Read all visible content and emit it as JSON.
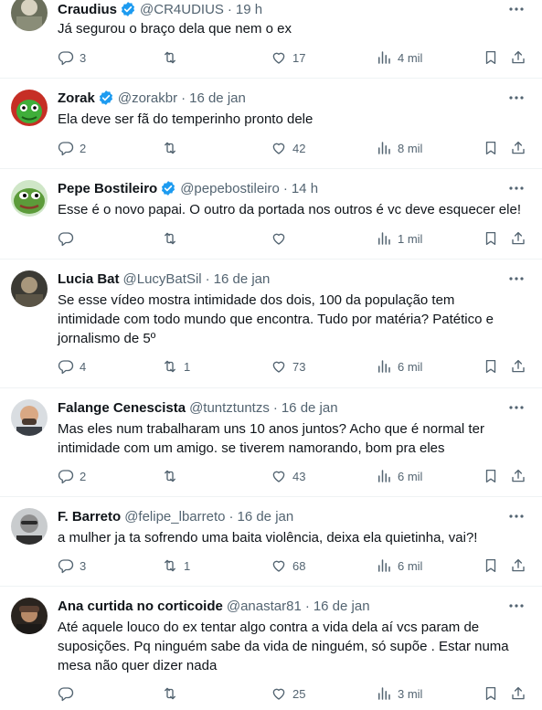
{
  "tweets": [
    {
      "name": "Craudius",
      "verified": true,
      "handle": "@CR4UDIUS",
      "time": "19 h",
      "lines": [
        "Já segurou o braço dela que nem o ex"
      ],
      "replies": "3",
      "retweets": "",
      "likes": "17",
      "views": "4 mil",
      "avatar_icon": "avatar-photo-craudius"
    },
    {
      "name": "Zorak",
      "verified": true,
      "handle": "@zorakbr",
      "time": "16 de jan",
      "lines": [
        "Ela deve ser fã do temperinho pronto dele"
      ],
      "replies": "2",
      "retweets": "",
      "likes": "42",
      "views": "8 mil",
      "avatar_icon": "avatar-zorak-cartoon"
    },
    {
      "name": "Pepe Bostileiro",
      "verified": true,
      "handle": "@pepebostileiro",
      "time": "14 h",
      "lines": [
        "Esse é o novo papai. O outro da portada nos outros é vc deve esquecer ele!"
      ],
      "replies": "",
      "retweets": "",
      "likes": "",
      "views": "1 mil",
      "avatar_icon": "avatar-pepe-frog"
    },
    {
      "name": "Lucia Bat",
      "verified": false,
      "handle": "@LucyBatSil",
      "time": "16 de jan",
      "lines": [
        "Se esse vídeo mostra intimidade dos dois, 100 da população tem",
        "intimidade com todo mundo que encontra. Tudo por matéria? Patético e",
        "jornalismo de 5º"
      ],
      "replies": "4",
      "retweets": "1",
      "likes": "73",
      "views": "6 mil",
      "avatar_icon": "avatar-photo-lucia"
    },
    {
      "name": "Falange Cenescista",
      "verified": false,
      "handle": "@tuntztuntzs",
      "time": "16 de jan",
      "lines": [
        "Mas eles num trabalharam uns 10 anos juntos? Acho que é normal ter",
        "intimidade com um amigo. se tiverem namorando, bom pra eles"
      ],
      "replies": "2",
      "retweets": "",
      "likes": "43",
      "views": "6 mil",
      "avatar_icon": "avatar-photo-falange"
    },
    {
      "name": "F. Barreto",
      "verified": false,
      "handle": "@felipe_lbarreto",
      "time": "16 de jan",
      "lines": [
        "a mulher ja ta sofrendo uma baita violência, deixa ela quietinha, vai?!"
      ],
      "replies": "3",
      "retweets": "1",
      "likes": "68",
      "views": "6 mil",
      "avatar_icon": "avatar-photo-barreto"
    },
    {
      "name": "Ana curtida no corticoide",
      "verified": false,
      "handle": "@anastar81",
      "time": "16 de jan",
      "lines": [
        "Até aquele louco do  ex tentar algo contra a vida dela aí vcs param de",
        "suposições. Pq ninguém sabe da vida de ninguém, só supõe . Estar numa",
        "mesa não quer dizer nada"
      ],
      "replies": "",
      "retweets": "",
      "likes": "25",
      "views": "3 mil",
      "avatar_icon": "avatar-photo-ana"
    }
  ],
  "colors": {
    "text": "#0f1419",
    "secondary": "#536471",
    "verified": "#1d9bf0",
    "divider": "#eff3f4"
  },
  "icons": [
    "reply-icon",
    "retweet-icon",
    "like-icon",
    "views-icon",
    "bookmark-icon",
    "share-icon",
    "more-icon",
    "verified-badge-icon"
  ]
}
